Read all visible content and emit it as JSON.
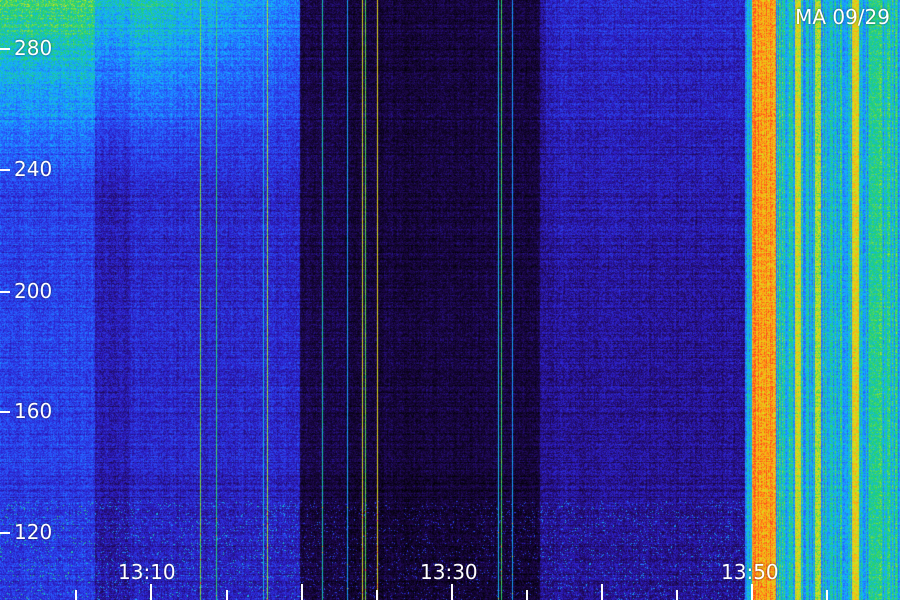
{
  "station_label": "MA 09/29",
  "frequency_axis": {
    "tick_labels": [
      "280",
      "240",
      "200",
      "160",
      "120"
    ]
  },
  "time_axis": {
    "tick_labels": [
      "13:10",
      "13:30",
      "13:50"
    ]
  },
  "colors": {
    "background": "#000000",
    "noise_floor": "#2a0f7a",
    "low_intensity": "#3b2fd6",
    "medium_intensity": "#1f9dff",
    "high_intensity": "#2bd06a",
    "peak_intensity": "#ffd21a",
    "saturation": "#ff5a1a",
    "text": "#ffffff"
  }
}
